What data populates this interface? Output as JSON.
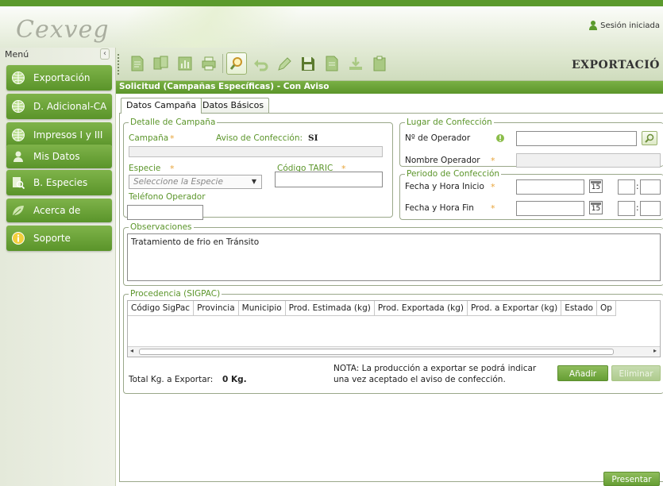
{
  "app": {
    "logo_text": "Cexveg",
    "session_text": "Sesión iniciada",
    "page_heading": "EXPORTACIÓ"
  },
  "colors": {
    "accent": "#5b952a",
    "accent_light": "#7ab045",
    "required_label": "#5b952a"
  },
  "sidebar": {
    "menu_label": "Menú",
    "collapse_glyph": "‹",
    "items": [
      {
        "label": "Exportación",
        "icon": "globe-icon"
      },
      {
        "label": "D. Adicional-CA",
        "icon": "globe-icon"
      },
      {
        "label": "Impresos I y III",
        "icon": "globe-icon"
      },
      {
        "label": "Mis Datos",
        "icon": "user-icon"
      },
      {
        "label": "B. Especies",
        "icon": "search-doc-icon"
      },
      {
        "label": "Acerca de",
        "icon": "leaf-icon"
      },
      {
        "label": "Soporte",
        "icon": "info-icon"
      }
    ]
  },
  "toolbar": {
    "buttons": [
      "new-document-icon",
      "copy-documents-icon",
      "chart-icon",
      "print-icon",
      "search-icon",
      "undo-icon",
      "edit-icon",
      "save-icon",
      "document-icon",
      "download-icon",
      "clipboard-icon"
    ]
  },
  "form": {
    "title": "Solicitud (Campañas Específicas) - Con Aviso",
    "tabs": [
      "Datos Campaña",
      "Datos Básicos"
    ],
    "detalle": {
      "legend": "Detalle de Campaña",
      "campana_label": "Campaña",
      "aviso_label": "Aviso de Confección:",
      "aviso_value": "SI",
      "especie_label": "Especie",
      "especie_placeholder": "Seleccione la Especie",
      "taric_label": "Código TARIC",
      "telefono_label": "Teléfono Operador"
    },
    "lugar": {
      "legend": "Lugar de Confección",
      "operador_label": "Nº de Operador",
      "nombre_label": "Nombre Operador"
    },
    "periodo": {
      "legend": "Periodo de Confección",
      "inicio_label": "Fecha y Hora Inicio",
      "fin_label": "Fecha y Hora Fin",
      "calendar_text": "15",
      "time_sep": ":"
    },
    "observaciones": {
      "legend": "Observaciones",
      "value": "Tratamiento de frio en Tránsito"
    },
    "procedencia": {
      "legend": "Procedencia (SIGPAC)",
      "columns": [
        "Código SigPac",
        "Provincia",
        "Municipio",
        "Prod. Estimada (kg)",
        "Prod. Exportada (kg)",
        "Prod. a Exportar (kg)",
        "Estado",
        "Op"
      ],
      "total_label": "Total Kg. a Exportar:",
      "total_value": "0 Kg.",
      "note_line1": "NOTA: La producción a exportar se podrá indicar",
      "note_line2": "una vez aceptado el aviso de confección.",
      "add_button": "Añadir",
      "delete_button": "Eliminar"
    },
    "submit_button": "Presentar"
  }
}
